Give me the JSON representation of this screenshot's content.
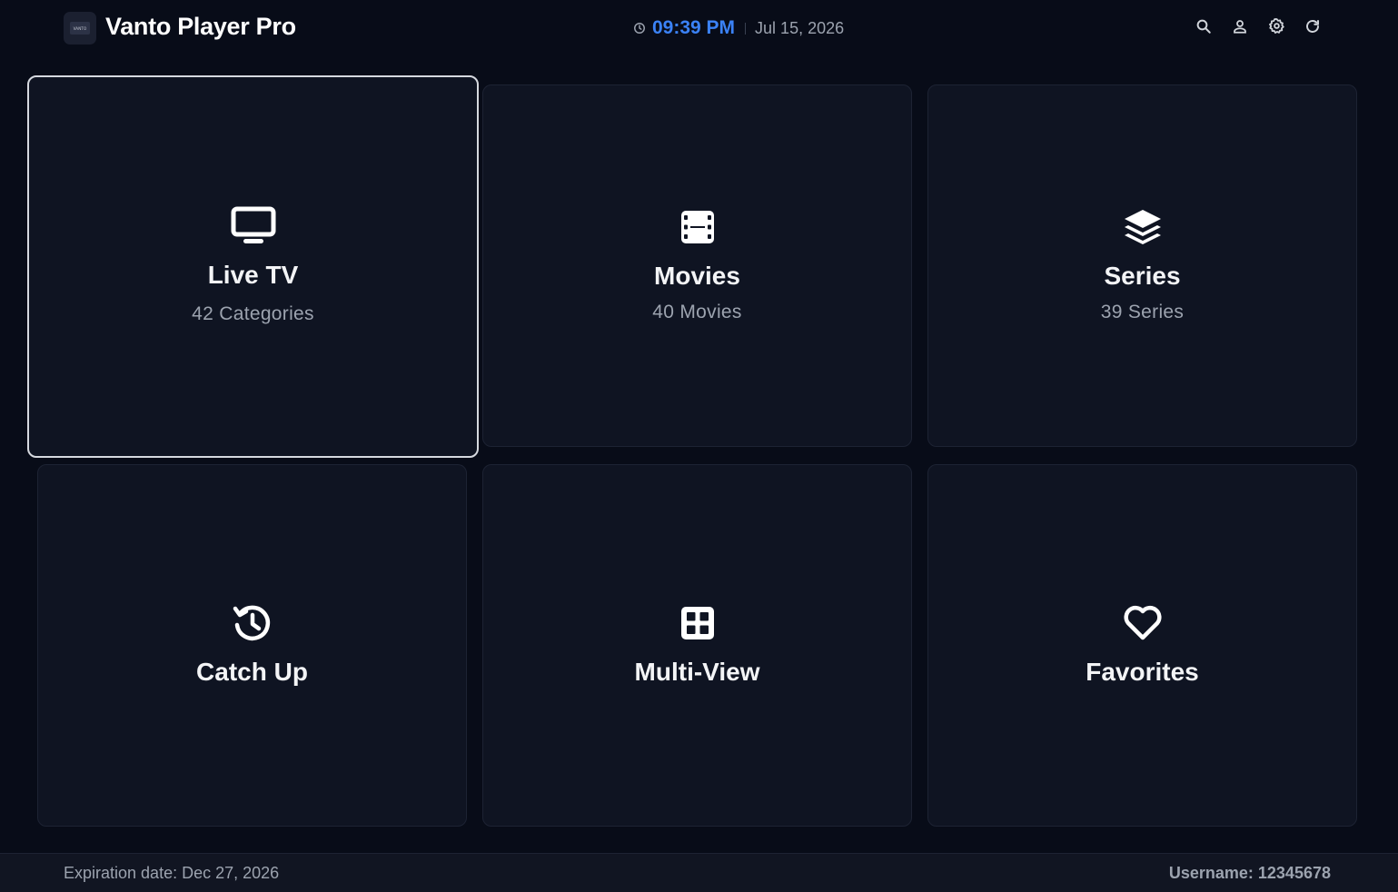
{
  "app": {
    "title": "Vanto Player Pro",
    "logo_text": "VANTO"
  },
  "header": {
    "time": "09:39 PM",
    "date": "Jul 15, 2026",
    "actions": [
      {
        "icon": "search-icon"
      },
      {
        "icon": "user-icon"
      },
      {
        "icon": "gear-icon"
      },
      {
        "icon": "refresh-icon"
      }
    ]
  },
  "tiles": [
    {
      "title": "Live TV",
      "subtitle": "42 Categories",
      "icon": "tv-icon",
      "focused": true
    },
    {
      "title": "Movies",
      "subtitle": "40 Movies",
      "icon": "film-icon",
      "focused": false
    },
    {
      "title": "Series",
      "subtitle": "39 Series",
      "icon": "layers-icon",
      "focused": false
    },
    {
      "title": "Catch Up",
      "subtitle": "",
      "icon": "history-icon",
      "focused": false
    },
    {
      "title": "Multi-View",
      "subtitle": "",
      "icon": "grid-icon",
      "focused": false
    },
    {
      "title": "Favorites",
      "subtitle": "",
      "icon": "heart-icon",
      "focused": false
    }
  ],
  "footer": {
    "expiration": "Expiration date: Dec 27, 2026",
    "username": "Username: 12345678"
  },
  "colors": {
    "background": "#080c18",
    "tile": "#0f1422",
    "accent": "#3b82f6",
    "muted_text": "#9ca3af"
  }
}
